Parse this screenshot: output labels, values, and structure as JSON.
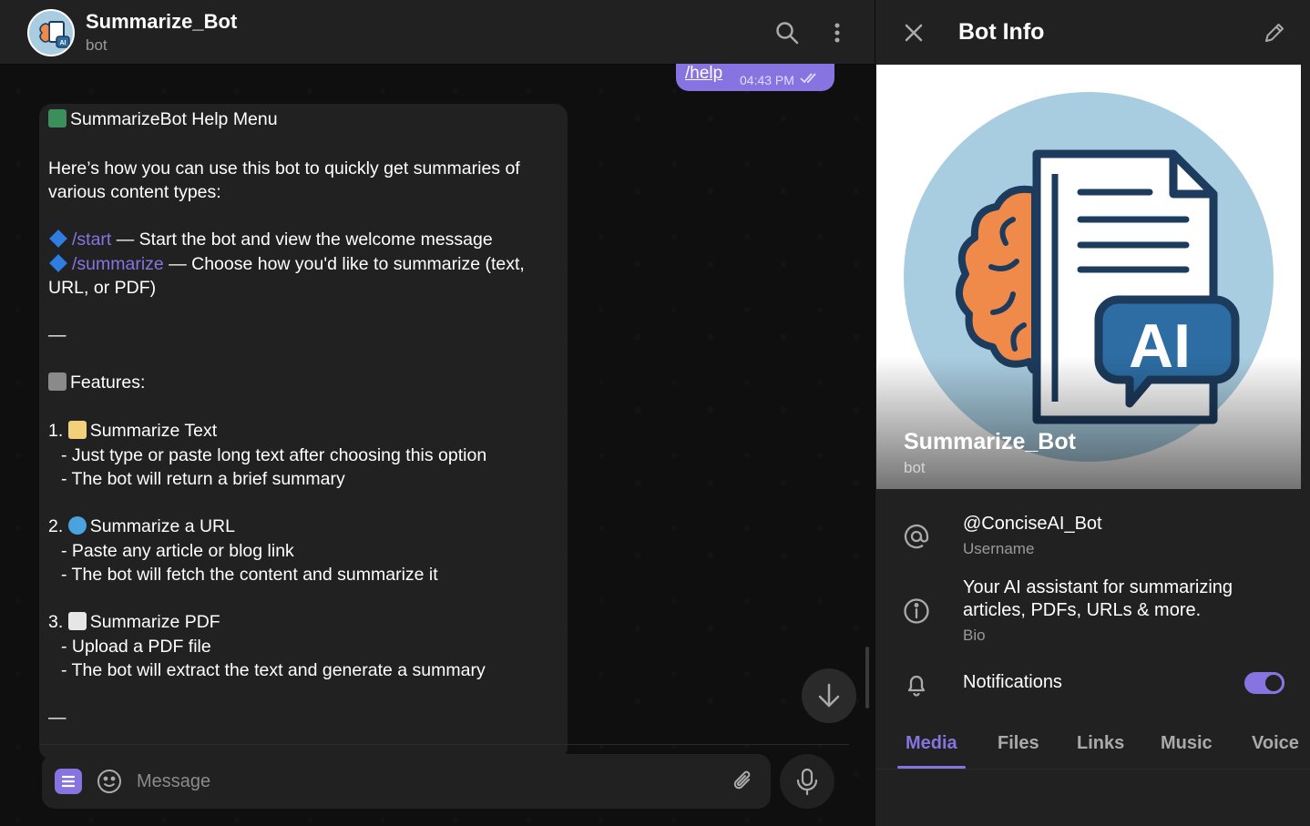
{
  "chat": {
    "title": "Summarize_Bot",
    "subtitle": "bot",
    "outgoing": {
      "text": "/help",
      "time": "04:43 PM"
    },
    "message": {
      "heading": "SummarizeBot Help Menu",
      "intro_1": "Here’s how you can use this bot to quickly get summaries of",
      "intro_2": "various content types:",
      "cmd_start": "/start",
      "cmd_start_desc": " — Start the bot and view the welcome message",
      "cmd_summarize": "/summarize",
      "cmd_summarize_desc": " — Choose how you'd like to summarize (text,",
      "cmd_summarize_desc_2": "URL, or PDF)",
      "sep": "—",
      "features": "Features:",
      "f1_num": "1.",
      "f1_title": "Summarize Text",
      "f1_a": "- Just type or paste long text after choosing this option",
      "f1_b": "- The bot will return a brief summary",
      "f2_num": "2.",
      "f2_title": "Summarize a URL",
      "f2_a": "- Paste any article or blog link",
      "f2_b": "- The bot will fetch the content and summarize it",
      "f3_num": "3.",
      "f3_title": "Summarize PDF",
      "f3_a": "- Upload a PDF file",
      "f3_b": "- The bot will extract the text and generate a summary",
      "sep2": "—"
    },
    "composer": {
      "placeholder": "Message"
    }
  },
  "info": {
    "title": "Bot Info",
    "hero_name": "Summarize_Bot",
    "hero_sub": "bot",
    "username": "@ConciseAI_Bot",
    "username_label": "Username",
    "bio_1": "Your AI assistant for summarizing",
    "bio_2": "articles, PDFs, URLs & more.",
    "bio_label": "Bio",
    "notifications": "Notifications",
    "notifications_on": true,
    "tabs": [
      "Media",
      "Files",
      "Links",
      "Music",
      "Voice"
    ],
    "logo_text": "AI"
  },
  "colors": {
    "accent": "#8774e1",
    "panel": "#212121",
    "background": "#0f0f0f"
  }
}
